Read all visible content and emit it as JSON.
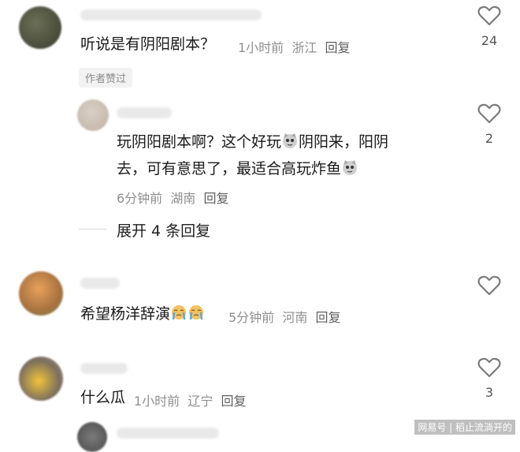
{
  "comments": [
    {
      "text": "听说是有阴阳剧本？",
      "time": "1小时前",
      "location": "浙江",
      "reply_label": "回复",
      "likes": "24",
      "badge": "作者赞过"
    },
    {
      "text_line1_a": "玩阴阳剧本啊？这个好玩",
      "text_line1_b": "阴阳来，阳阴",
      "text_line2_a": "去，可有意思了，最适合高玩炸鱼",
      "time": "6分钟前",
      "location": "湖南",
      "reply_label": "回复",
      "likes": "2"
    },
    {
      "text": "希望杨洋辞演",
      "time": "5分钟前",
      "location": "河南",
      "reply_label": "回复"
    },
    {
      "text": "什么瓜",
      "time": "1小时前",
      "location": "辽宁",
      "reply_label": "回复",
      "likes": "3"
    }
  ],
  "expand_label": "展开 4 条回复",
  "watermark": "网易号 | 稻止流淌开的",
  "colors": {
    "meta": "#8f8f8f",
    "text": "#1a1a1a",
    "heart": "#7a7a7a"
  }
}
